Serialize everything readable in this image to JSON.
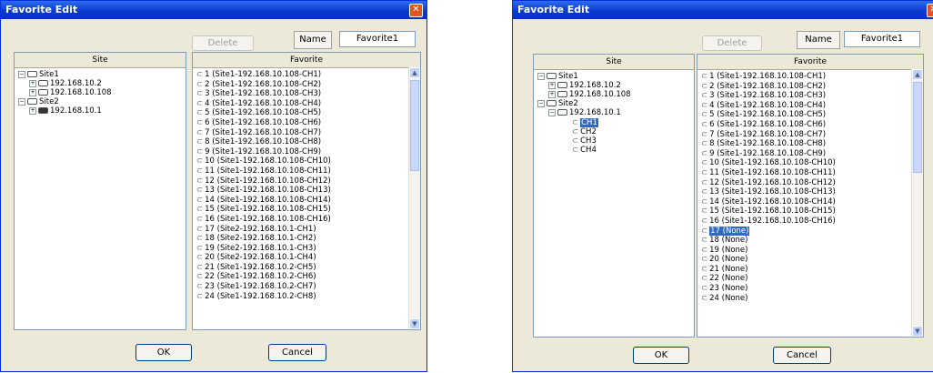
{
  "dialog_title": "Favorite Edit",
  "close_glyph": "✕",
  "buttons": {
    "delete": "Delete",
    "ok": "OK",
    "cancel": "Cancel"
  },
  "name_label": "Name",
  "name_value": "Favorite1",
  "site_header": "Site",
  "favorite_header": "Favorite",
  "scroll_up": "▲",
  "scroll_down": "▼",
  "cam_glyph": "⊂",
  "tree_glyphs": {
    "collapse": "−",
    "expand": "+"
  },
  "left": {
    "tree": [
      "Site1",
      "192.168.10.2",
      "192.168.10.108",
      "Site2",
      "192.168.10.1"
    ],
    "favorites": [
      "1 (Site1-192.168.10.108-CH1)",
      "2 (Site1-192.168.10.108-CH2)",
      "3 (Site1-192.168.10.108-CH3)",
      "4 (Site1-192.168.10.108-CH4)",
      "5 (Site1-192.168.10.108-CH5)",
      "6 (Site1-192.168.10.108-CH6)",
      "7 (Site1-192.168.10.108-CH7)",
      "8 (Site1-192.168.10.108-CH8)",
      "9 (Site1-192.168.10.108-CH9)",
      "10 (Site1-192.168.10.108-CH10)",
      "11 (Site1-192.168.10.108-CH11)",
      "12 (Site1-192.168.10.108-CH12)",
      "13 (Site1-192.168.10.108-CH13)",
      "14 (Site1-192.168.10.108-CH14)",
      "15 (Site1-192.168.10.108-CH15)",
      "16 (Site1-192.168.10.108-CH16)",
      "17 (Site2-192.168.10.1-CH1)",
      "18 (Site2-192.168.10.1-CH2)",
      "19 (Site2-192.168.10.1-CH3)",
      "20 (Site2-192.168.10.1-CH4)",
      "21 (Site1-192.168.10.2-CH5)",
      "22 (Site1-192.168.10.2-CH6)",
      "23 (Site1-192.168.10.2-CH7)",
      "24 (Site1-192.168.10.2-CH8)"
    ]
  },
  "right": {
    "tree": [
      "Site1",
      "192.168.10.2",
      "192.168.10.108",
      "Site2",
      "192.168.10.1",
      "CH1",
      "CH2",
      "CH3",
      "CH4"
    ],
    "favorites": [
      "1 (Site1-192.168.10.108-CH1)",
      "2 (Site1-192.168.10.108-CH2)",
      "3 (Site1-192.168.10.108-CH3)",
      "4 (Site1-192.168.10.108-CH4)",
      "5 (Site1-192.168.10.108-CH5)",
      "6 (Site1-192.168.10.108-CH6)",
      "7 (Site1-192.168.10.108-CH7)",
      "8 (Site1-192.168.10.108-CH8)",
      "9 (Site1-192.168.10.108-CH9)",
      "10 (Site1-192.168.10.108-CH10)",
      "11 (Site1-192.168.10.108-CH11)",
      "12 (Site1-192.168.10.108-CH12)",
      "13 (Site1-192.168.10.108-CH13)",
      "14 (Site1-192.168.10.108-CH14)",
      "15 (Site1-192.168.10.108-CH15)",
      "16 (Site1-192.168.10.108-CH16)",
      "17 (None)",
      "18 (None)",
      "19 (None)",
      "20 (None)",
      "21 (None)",
      "22 (None)",
      "23 (None)",
      "24 (None)"
    ]
  },
  "colors": {
    "titlebar": "#0a3ccd",
    "dialog_bg": "#ece9d8",
    "selection": "#316ac5"
  }
}
